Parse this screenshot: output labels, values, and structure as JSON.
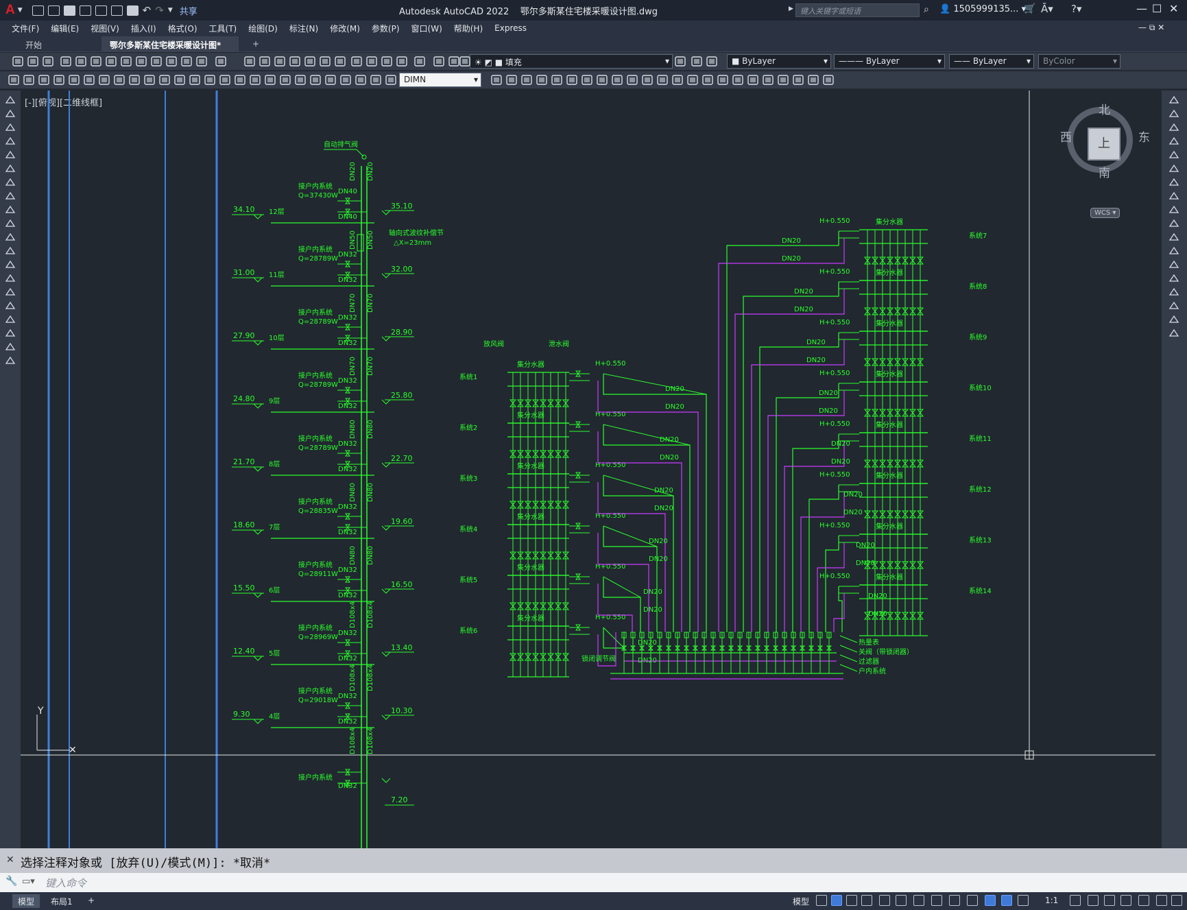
{
  "app": {
    "logo": "A",
    "title": "Autodesk AutoCAD 2022    鄂尔多斯某住宅楼采暖设计图.dwg",
    "share": "共享",
    "search_placeholder": "键入关键字或短语",
    "user": "1505999135...",
    "win_controls": [
      "—",
      "☐",
      "✕"
    ]
  },
  "menu": [
    "文件(F)",
    "编辑(E)",
    "视图(V)",
    "插入(I)",
    "格式(O)",
    "工具(T)",
    "绘图(D)",
    "标注(N)",
    "修改(M)",
    "参数(P)",
    "窗口(W)",
    "帮助(H)",
    "Express"
  ],
  "tabs": {
    "start": "开始",
    "doc": "鄂尔多斯某住宅楼采暖设计图*",
    "add": "+"
  },
  "toolbar": {
    "layer": "填充",
    "color": "ByLayer",
    "linetype": "ByLayer",
    "lineweight": "ByLayer",
    "plotstyle": "ByColor",
    "dimstyle": "DIMN"
  },
  "viewport_label": "[-][俯视][二维线框]",
  "viewcube": {
    "n": "北",
    "s": "南",
    "e": "东",
    "w": "西",
    "top": "上",
    "wcs": "WCS"
  },
  "ucs": {
    "y": "Y"
  },
  "riser": {
    "vent": "自动排气阀",
    "comp": "轴向式波纹补偿节",
    "delta": "△X=23mm",
    "sys": "接户内系统",
    "top_pipe": [
      "DN20",
      "DN20"
    ],
    "floors": [
      {
        "lv": "34.10",
        "fl": "12层",
        "q": "Q=37430W",
        "d1": "DN40",
        "d2": "DN40",
        "r": "35.10",
        "p": [
          "DN50",
          "DN50"
        ]
      },
      {
        "lv": "31.00",
        "fl": "11层",
        "q": "Q=28789W",
        "d1": "DN32",
        "d2": "DN32",
        "r": "32.00",
        "p": [
          "DN70",
          "DN70"
        ]
      },
      {
        "lv": "27.90",
        "fl": "10层",
        "q": "Q=28789W",
        "d1": "DN32",
        "d2": "DN32",
        "r": "28.90",
        "p": [
          "DN70",
          "DN70"
        ]
      },
      {
        "lv": "24.80",
        "fl": "9层",
        "q": "Q=28789W",
        "d1": "DN32",
        "d2": "DN32",
        "r": "25.80",
        "p": [
          "DN80",
          "DN80"
        ]
      },
      {
        "lv": "21.70",
        "fl": "8层",
        "q": "Q=28789W",
        "d1": "DN32",
        "d2": "DN32",
        "r": "22.70",
        "p": [
          "DN80",
          "DN80"
        ]
      },
      {
        "lv": "18.60",
        "fl": "7层",
        "q": "Q=28835W",
        "d1": "DN32",
        "d2": "DN32",
        "r": "19.60",
        "p": [
          "DN80",
          "DN80"
        ]
      },
      {
        "lv": "15.50",
        "fl": "6层",
        "q": "Q=28911W",
        "d1": "DN32",
        "d2": "DN32",
        "r": "16.50",
        "p": [
          "D108x4",
          "D108x4"
        ]
      },
      {
        "lv": "12.40",
        "fl": "5层",
        "q": "Q=28969W",
        "d1": "DN32",
        "d2": "DN32",
        "r": "13.40",
        "p": [
          "D108x4",
          "D108x4"
        ]
      },
      {
        "lv": "9.30",
        "fl": "4层",
        "q": "Q=29018W",
        "d1": "DN32",
        "d2": "DN32",
        "r": "10.30",
        "p": [
          "D108x4",
          "D108x4"
        ]
      },
      {
        "lv": "",
        "fl": "",
        "q": "",
        "d1": "DN32",
        "d2": "",
        "r": "7.20",
        "p": [
          "D108x4"
        ]
      }
    ]
  },
  "manifold": {
    "label": "集分水器",
    "h": "H+0.550",
    "exhaust": "放风阀",
    "drain": "泄水阀",
    "pipe": "DN20",
    "left": [
      "系统1",
      "系统2",
      "系统3",
      "系统4",
      "系统5",
      "系统6"
    ],
    "right": [
      "系统7",
      "系统8",
      "系统9",
      "系统10",
      "系统11",
      "系统12",
      "系统13",
      "系统14"
    ],
    "bottom": [
      "锁闭调节阀",
      "热量表",
      "关阀（带锁闭器）",
      "过滤器",
      "户内系统"
    ]
  },
  "command": {
    "history": "选择注释对象或 [放弃(U)/模式(M)]: *取消*",
    "placeholder": "键入命令"
  },
  "status": {
    "model": "模型",
    "layout": "布局1",
    "add": "+",
    "model_btn": "模型",
    "scale": "1:1"
  }
}
